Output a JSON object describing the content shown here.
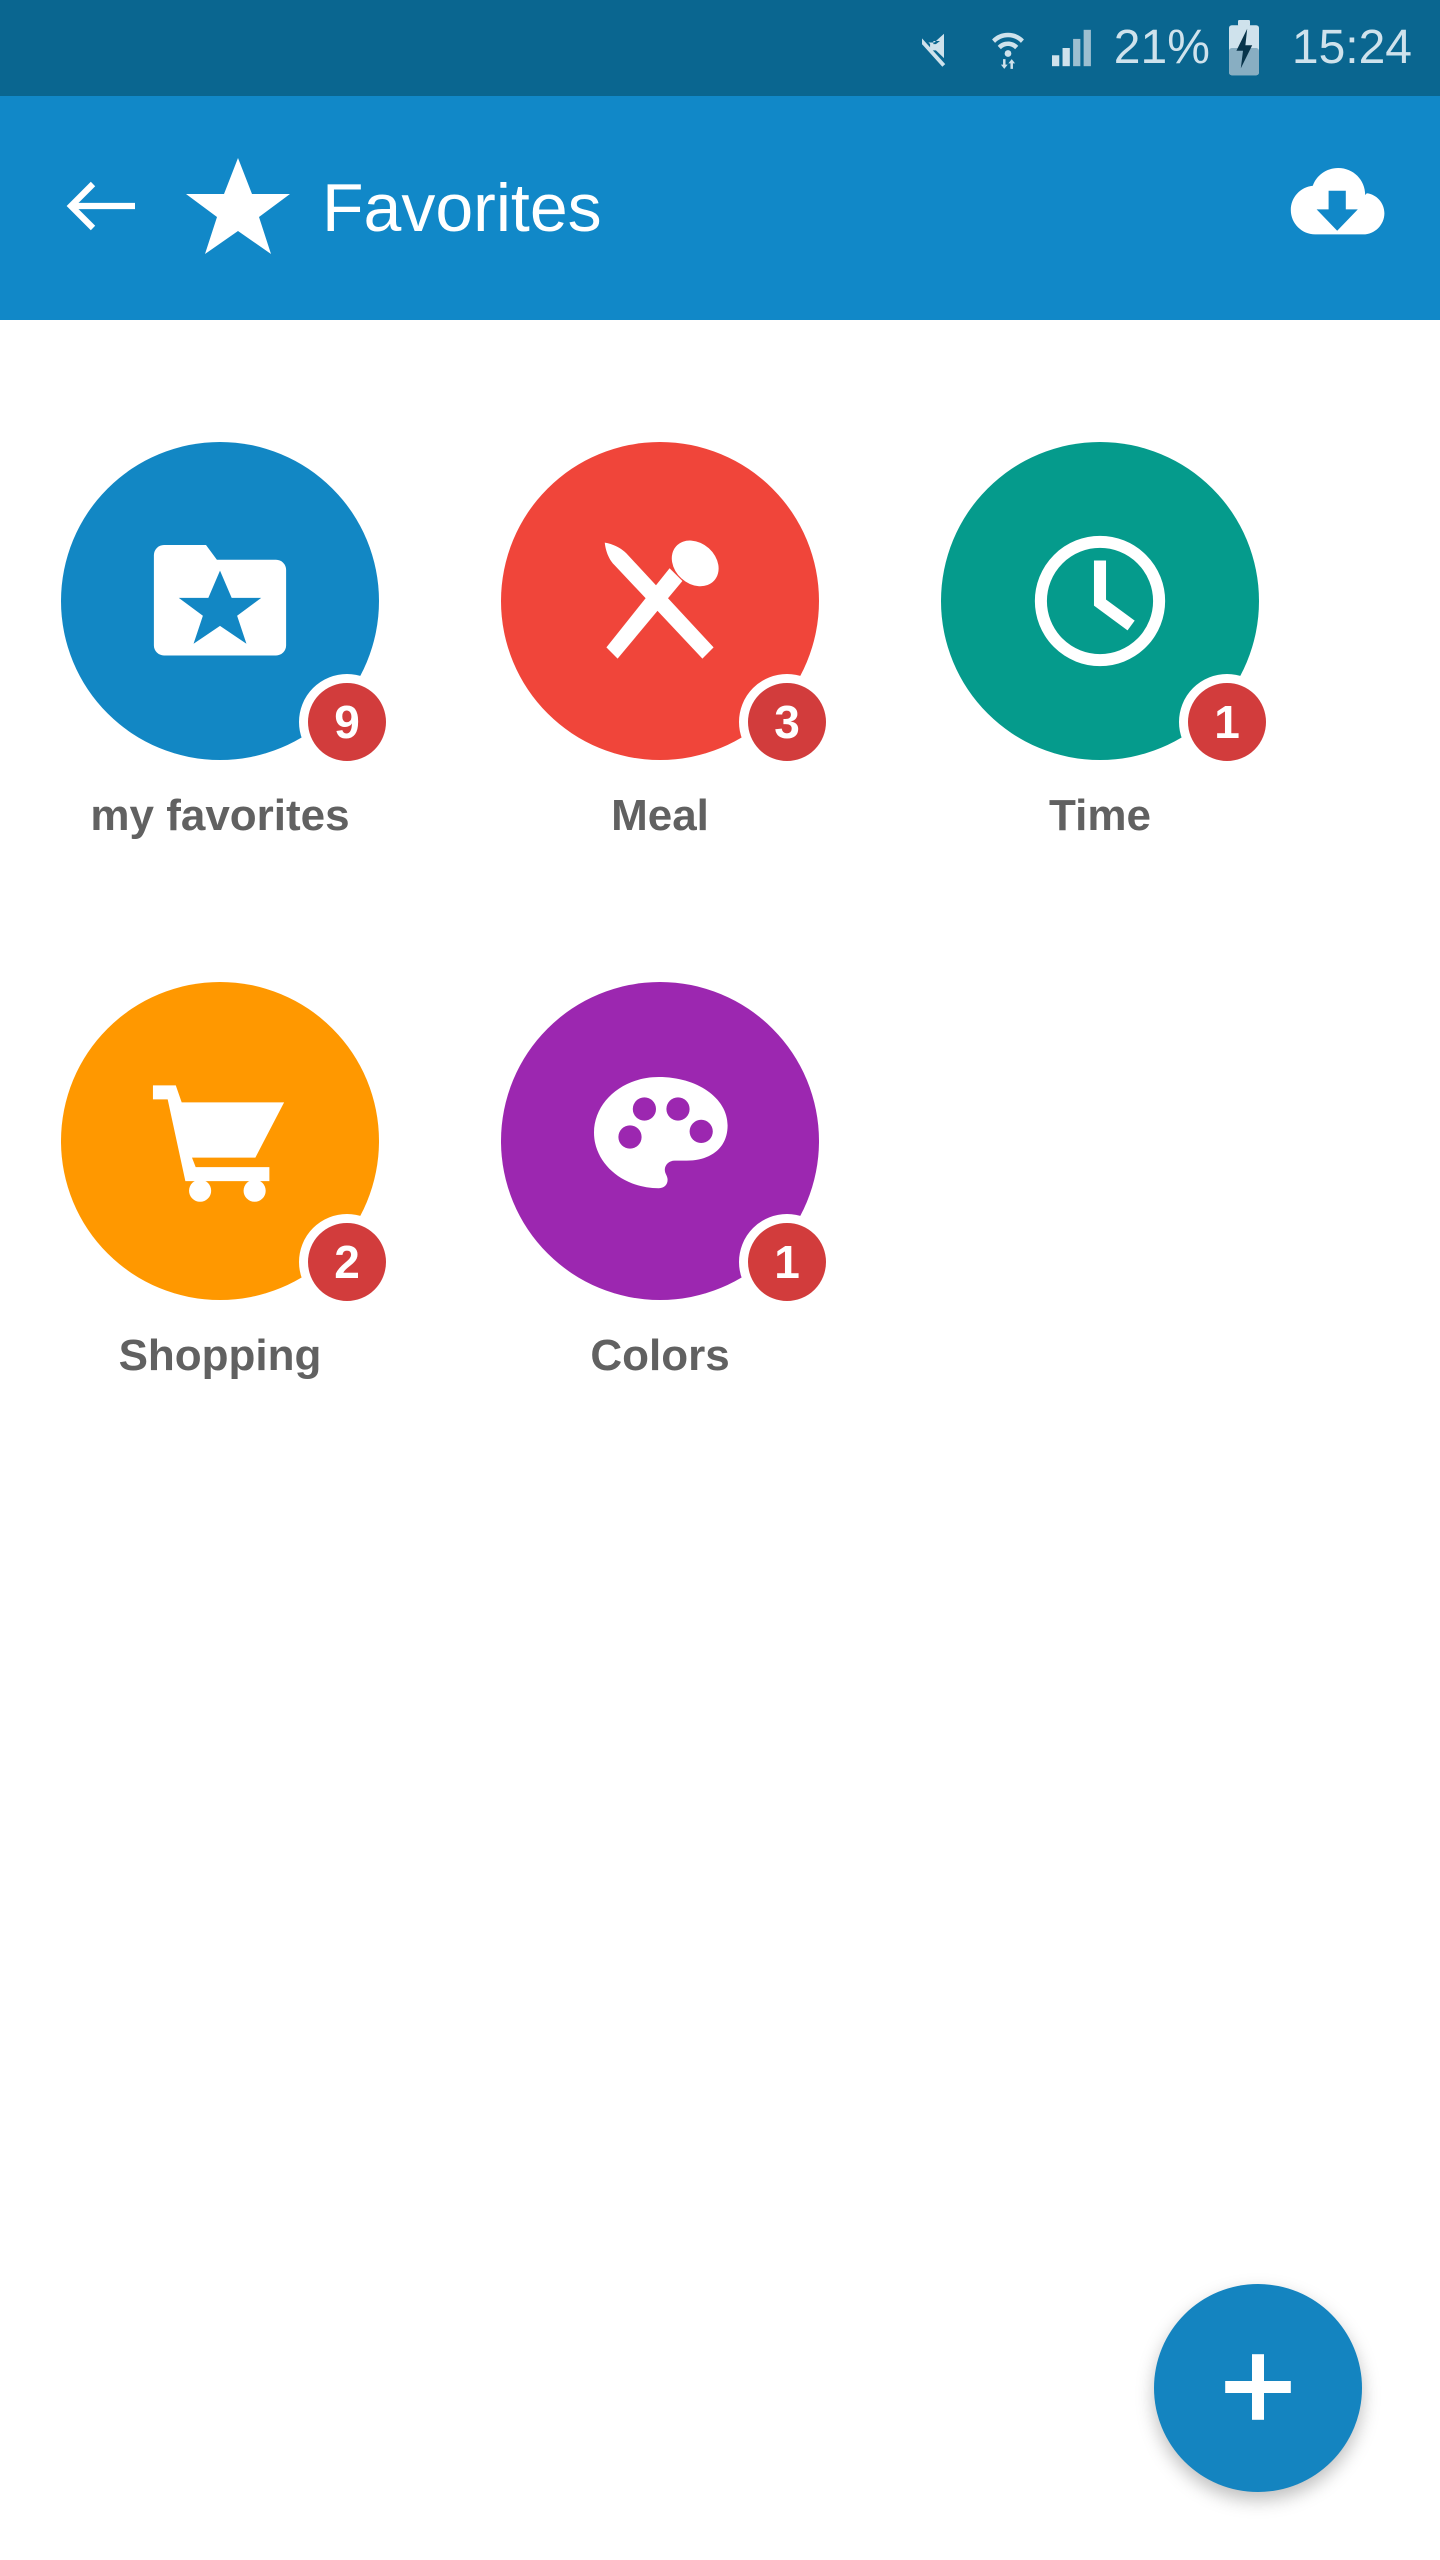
{
  "status_bar": {
    "background": "#0a6690",
    "text_color": "#cfe2ec",
    "mute_icon": "mute-icon",
    "wifi_icon": "wifi-icon",
    "signal_icon": "cellular-signal-icon",
    "battery_percent": "21%",
    "battery_icon": "battery-charging-icon",
    "clock": "15:24"
  },
  "app_bar": {
    "background": "#1188c8",
    "back_icon": "back-arrow-icon",
    "logo_icon": "star-icon",
    "title": "Favorites",
    "action_icon": "cloud-download-icon"
  },
  "grid": {
    "items": [
      {
        "label": "my favorites",
        "badge": "9",
        "color": "#1287c4",
        "icon": "folder-star-icon"
      },
      {
        "label": "Meal",
        "badge": "3",
        "color": "#f0453a",
        "icon": "spoon-knife-icon"
      },
      {
        "label": "Time",
        "badge": "1",
        "color": "#059b8c",
        "icon": "clock-icon"
      },
      {
        "label": "Shopping",
        "badge": "2",
        "color": "#ff9800",
        "icon": "shopping-cart-icon"
      },
      {
        "label": "Colors",
        "badge": "1",
        "color": "#9c27b0",
        "icon": "palette-icon"
      }
    ],
    "badge_color": "#d23c3c",
    "label_color": "#616161"
  },
  "fab": {
    "icon": "plus-icon",
    "color": "#1484c0"
  }
}
